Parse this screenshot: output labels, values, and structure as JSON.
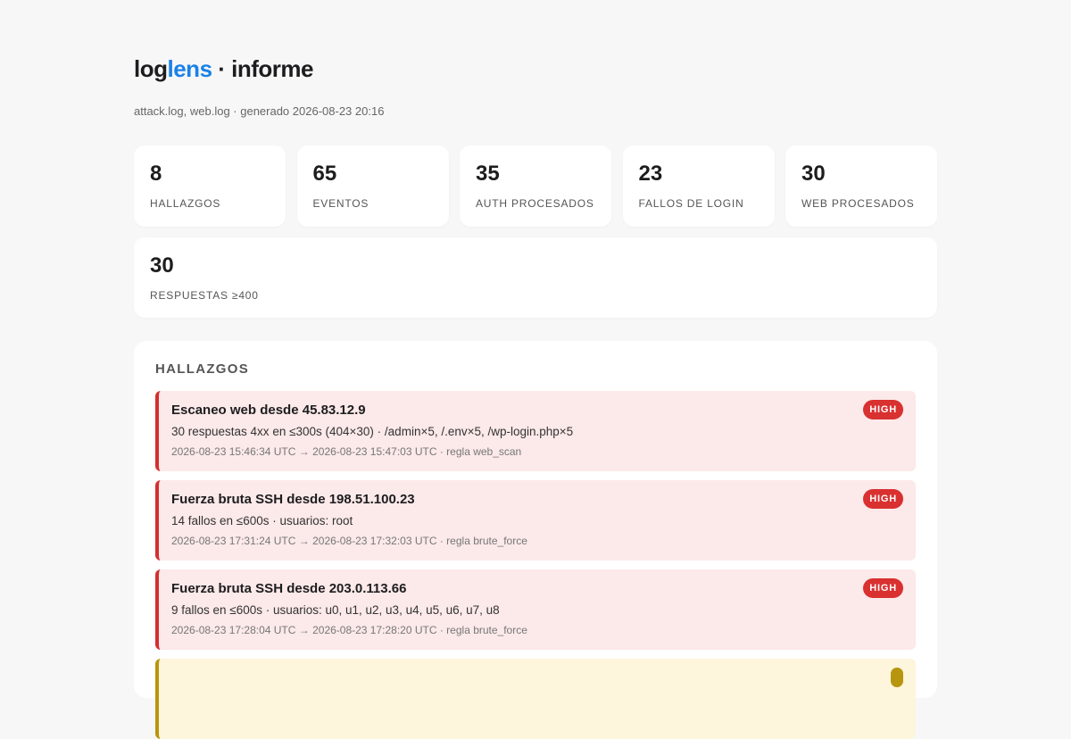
{
  "header": {
    "title_prefix": "log",
    "title_accent": "lens",
    "title_suffix": " · informe",
    "subtitle": "attack.log, web.log · generado 2026-08-23 20:16"
  },
  "stats": [
    {
      "value": "8",
      "label": "HALLAZGOS"
    },
    {
      "value": "65",
      "label": "EVENTOS"
    },
    {
      "value": "35",
      "label": "AUTH PROCESADOS"
    },
    {
      "value": "23",
      "label": "FALLOS DE LOGIN"
    },
    {
      "value": "30",
      "label": "WEB PROCESADOS"
    },
    {
      "value": "30",
      "label": "RESPUESTAS ≥400"
    }
  ],
  "findings_section": {
    "heading": "HALLAZGOS",
    "items": [
      {
        "title": "Escaneo web desde 45.83.12.9",
        "detail": "30 respuestas 4xx en ≤300s (404×30) · /admin×5, /.env×5, /wp-login.php×5",
        "meta": "2026-08-23 15:46:34 UTC → 2026-08-23 15:47:03 UTC · regla web_scan",
        "severity": "HIGH"
      },
      {
        "title": "Fuerza bruta SSH desde 198.51.100.23",
        "detail": "14 fallos en ≤600s · usuarios: root",
        "meta": "2026-08-23 17:31:24 UTC → 2026-08-23 17:32:03 UTC · regla brute_force",
        "severity": "HIGH"
      },
      {
        "title": "Fuerza bruta SSH desde 203.0.113.66",
        "detail": "9 fallos en ≤600s · usuarios: u0, u1, u2, u3, u4, u5, u6, u7, u8",
        "meta": "2026-08-23 17:28:04 UTC → 2026-08-23 17:28:20 UTC · regla brute_force",
        "severity": "HIGH"
      },
      {
        "title": "",
        "detail": "",
        "meta": "",
        "severity": ""
      }
    ]
  },
  "colors": {
    "accent": "#1a82e8",
    "high_bg": "#fce9e9",
    "high_border": "#d32f2f",
    "high_badge": "#d93030",
    "medium_bg": "#fdf5dc",
    "medium_border": "#b8950e"
  }
}
